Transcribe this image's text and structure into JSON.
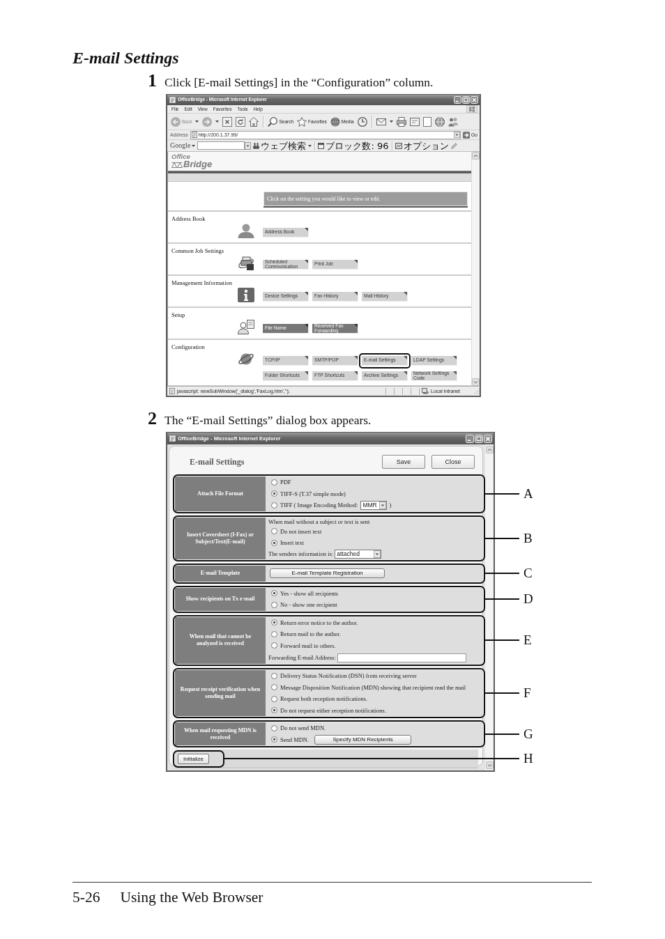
{
  "heading": "E-mail Settings",
  "step_1": {
    "number": "1",
    "text": "Click [E-mail Settings] in the “Configuration” column."
  },
  "browser_window": {
    "title": "OfficeBridge - Microsoft Internet Explorer",
    "menu": [
      "File",
      "Edit",
      "View",
      "Favorites",
      "Tools",
      "Help"
    ],
    "toolbar": [
      {
        "kind": "back",
        "label": "Back",
        "disabled": true
      },
      {
        "kind": "forward",
        "disabled": true
      },
      {
        "kind": "stop",
        "disabled": false
      },
      {
        "kind": "refresh",
        "disabled": false
      },
      {
        "kind": "home",
        "disabled": false
      },
      {
        "kind": "search",
        "label": "Search",
        "disabled": false
      },
      {
        "kind": "favorites",
        "label": "Favorites",
        "disabled": false
      },
      {
        "kind": "media",
        "label": "Media",
        "disabled": false
      },
      {
        "kind": "history",
        "disabled": false
      },
      {
        "kind": "mail",
        "disabled": false
      },
      {
        "kind": "print",
        "disabled": false
      },
      {
        "kind": "edit",
        "disabled": false
      },
      {
        "kind": "note",
        "disabled": false
      },
      {
        "kind": "research",
        "disabled": false
      },
      {
        "kind": "messenger",
        "disabled": false
      }
    ],
    "address": {
      "label": "Address",
      "url": "http://200.1.37.99/",
      "go": "Go"
    },
    "google_bar": {
      "logo": "Google",
      "web_search": "ウェブ検索",
      "blocked": "ブロック数: 96",
      "options": "オプション"
    },
    "logo": {
      "line_1": "Office",
      "line_2": "Bridge"
    },
    "prompt": "Click on the setting you would like to view or edit.",
    "sections": [
      {
        "title": "Address Book",
        "kind": "person",
        "buttons": [
          {
            "label": "Address Book",
            "dark": false,
            "highlighted": false
          }
        ]
      },
      {
        "title": "Common Job Settings",
        "kind": "printer",
        "buttons": [
          {
            "label": "Scheduled Communication",
            "dark": false,
            "highlighted": false
          },
          {
            "label": "Print Job",
            "dark": false,
            "highlighted": false
          }
        ]
      },
      {
        "title": "Management Information",
        "kind": "info",
        "buttons": [
          {
            "label": "Device Settings",
            "dark": false,
            "highlighted": false
          },
          {
            "label": "Fax History",
            "dark": false,
            "highlighted": false
          },
          {
            "label": "Mail History",
            "dark": false,
            "highlighted": false
          }
        ]
      },
      {
        "title": "Setup",
        "kind": "setup",
        "buttons": [
          {
            "label": "File Name",
            "dark": true,
            "highlighted": false
          },
          {
            "label": "Received Fax Forwarding",
            "dark": true,
            "highlighted": false
          }
        ]
      },
      {
        "title": "Configuration",
        "kind": "globe",
        "buttons": [
          {
            "label": "TCP/IP",
            "dark": false,
            "highlighted": false
          },
          {
            "label": "SMTP/POP",
            "dark": false,
            "highlighted": false
          },
          {
            "label": "E-mail Settings",
            "dark": false,
            "highlighted": true
          },
          {
            "label": "LDAP Settings",
            "dark": false,
            "highlighted": false
          },
          {
            "label": "Folder Shortcuts",
            "dark": false,
            "highlighted": false
          },
          {
            "label": "FTP Shortcuts",
            "dark": false,
            "highlighted": false
          },
          {
            "label": "Archive Settings",
            "dark": false,
            "highlighted": false
          },
          {
            "label": "Network Settings Code",
            "dark": false,
            "highlighted": false
          }
        ]
      }
    ],
    "status_bar": {
      "text": "javascript: newSubWindow('_dialog','FaxLog.htm','');",
      "zone": "Local intranet"
    }
  },
  "step_2": {
    "number": "2",
    "text": "The “E-mail Settings” dialog box appears."
  },
  "dialog_window": {
    "title": "OfficeBridge - Microsoft Internet Explorer",
    "heading": "E-mail Settings",
    "buttons": [
      "Save",
      "Close"
    ],
    "settings": [
      {
        "label": "Attach File Format",
        "callout": "A",
        "lines": [
          {
            "kind": "radio",
            "text": "PDF",
            "selected": false
          },
          {
            "kind": "radio",
            "text": "TIFF-S (T.37 simple mode)",
            "selected": true
          },
          {
            "kind": "radio",
            "text": "TIFF ( Image Encoding Method:",
            "selected": false,
            "select": "MMR",
            "after": ")"
          }
        ]
      },
      {
        "label": "Insert Coversheet (I-Fax) or Subject/Text(E-mail)",
        "callout": "B",
        "lines": [
          {
            "kind": "text",
            "text": "When mail without a subject or text is sent"
          },
          {
            "kind": "radio",
            "text": "Do not insert text",
            "selected": false
          },
          {
            "kind": "radio",
            "text": "Insert text",
            "selected": true
          },
          {
            "kind": "select",
            "text": "The senders information is:",
            "value": "attached"
          }
        ]
      },
      {
        "label": "E-mail Template",
        "callout": "C",
        "lines": [
          {
            "kind": "button",
            "text": "E-mail Template Registration"
          }
        ]
      },
      {
        "label": "Show recipients on Tx e-mail",
        "callout": "D",
        "lines": [
          {
            "kind": "radio",
            "text": "Yes - show all recipients",
            "selected": true
          },
          {
            "kind": "radio",
            "text": "No - show one recipient",
            "selected": false
          }
        ]
      },
      {
        "label": "When mail that cannot be analyzed is received",
        "callout": "E",
        "lines": [
          {
            "kind": "radio",
            "text": "Return error notice to the author.",
            "selected": true
          },
          {
            "kind": "radio",
            "text": "Return mail to the author.",
            "selected": false
          },
          {
            "kind": "radio",
            "text": "Forward mail to others.",
            "selected": false
          },
          {
            "kind": "input",
            "text": "Forwarding E-mail Address:"
          }
        ]
      },
      {
        "label": "Request receipt verification when sending mail",
        "callout": "F",
        "lines": [
          {
            "kind": "radio",
            "text": "Delivery Status Notification (DSN) from receiving server",
            "selected": false
          },
          {
            "kind": "radio",
            "text": "Message Disposition Notification (MDN) showing that recipient read the mail",
            "selected": false
          },
          {
            "kind": "radio",
            "text": "Request both reception notifications.",
            "selected": false
          },
          {
            "kind": "radio",
            "text": "Do not request either reception notifications.",
            "selected": true
          }
        ]
      },
      {
        "label": "When mail requesting MDN is received",
        "callout": "G",
        "lines": [
          {
            "kind": "radio",
            "text": "Do not send MDN.",
            "selected": false
          },
          {
            "kind": "radio",
            "text": "Send MDN.",
            "selected": true,
            "button": "Specify MDN Recipients"
          }
        ]
      }
    ],
    "initialize": {
      "label": "Initialize",
      "callout": "H"
    }
  },
  "footer": {
    "page": "5-26",
    "title": "Using the Web Browser"
  }
}
